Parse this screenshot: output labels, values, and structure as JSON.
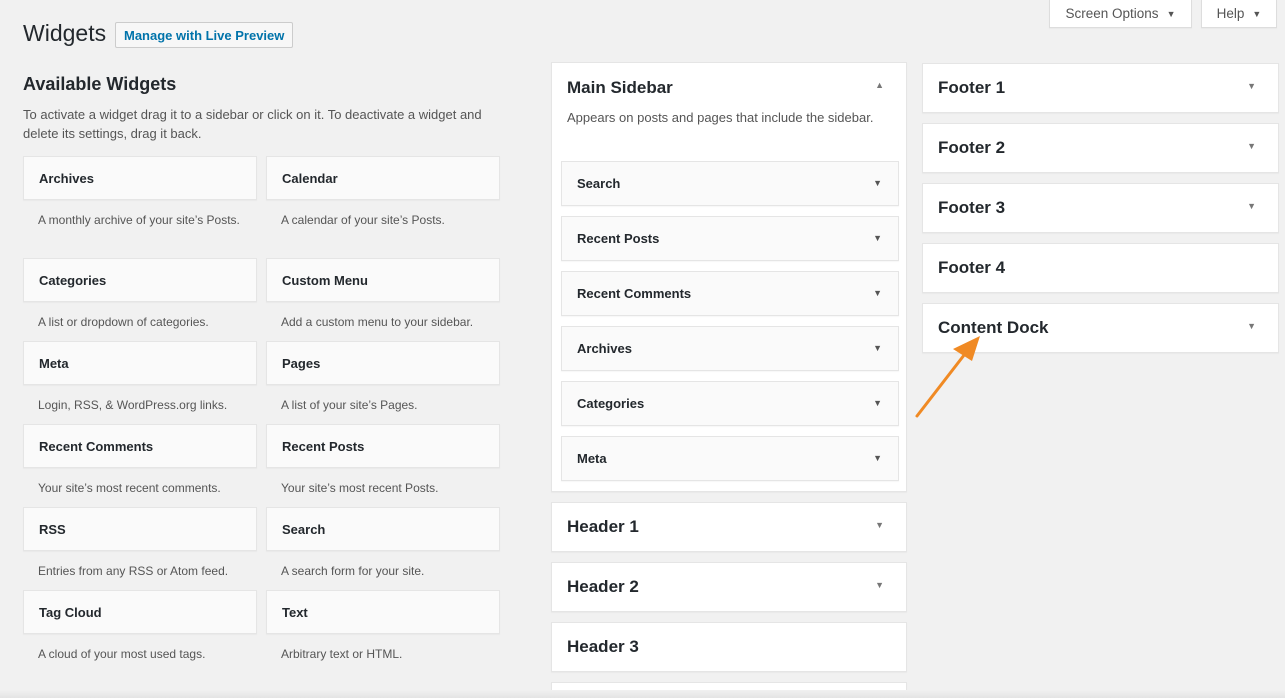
{
  "header": {
    "title": "Widgets",
    "live_preview_label": "Manage with Live Preview",
    "screen_options_label": "Screen Options",
    "help_label": "Help"
  },
  "available": {
    "title": "Available Widgets",
    "description": "To activate a widget drag it to a sidebar or click on it. To deactivate a widget and delete its settings, drag it back.",
    "widgets": [
      {
        "name": "Archives",
        "desc": "A monthly archive of your site’s Posts."
      },
      {
        "name": "Calendar",
        "desc": "A calendar of your site’s Posts."
      },
      {
        "name": "Categories",
        "desc": "A list or dropdown of categories."
      },
      {
        "name": "Custom Menu",
        "desc": "Add a custom menu to your sidebar."
      },
      {
        "name": "Meta",
        "desc": "Login, RSS, & WordPress.org links."
      },
      {
        "name": "Pages",
        "desc": "A list of your site’s Pages."
      },
      {
        "name": "Recent Comments",
        "desc": "Your site’s most recent comments."
      },
      {
        "name": "Recent Posts",
        "desc": "Your site’s most recent Posts."
      },
      {
        "name": "RSS",
        "desc": "Entries from any RSS or Atom feed."
      },
      {
        "name": "Search",
        "desc": "A search form for your site."
      },
      {
        "name": "Tag Cloud",
        "desc": "A cloud of your most used tags."
      },
      {
        "name": "Text",
        "desc": "Arbitrary text or HTML."
      }
    ]
  },
  "main_sidebar": {
    "title": "Main Sidebar",
    "description": "Appears on posts and pages that include the sidebar.",
    "widgets": [
      "Search",
      "Recent Posts",
      "Recent Comments",
      "Archives",
      "Categories",
      "Meta"
    ]
  },
  "middle_sidebars": [
    "Header 1",
    "Header 2",
    "Header 3"
  ],
  "right_sidebars": [
    "Footer 1",
    "Footer 2",
    "Footer 3",
    "Footer 4",
    "Content Dock"
  ],
  "colors": {
    "accent_link": "#0073aa",
    "annotation_arrow": "#f08a24"
  }
}
